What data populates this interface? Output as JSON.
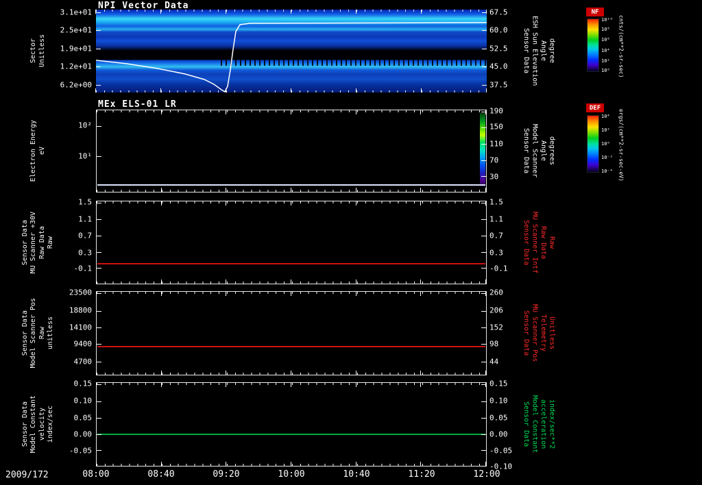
{
  "colors": {
    "background": "#000000",
    "text": "#ffffff",
    "red_label": "#ff2a2a",
    "green_label": "#00dd55",
    "red_line": "#cc1111",
    "green_line": "#00aa44",
    "badge_bg": "#cc0000"
  },
  "x_axis": {
    "date": "2009/172",
    "ticks": [
      "08:00",
      "08:40",
      "09:20",
      "10:00",
      "10:40",
      "11:20",
      "12:00"
    ]
  },
  "colorbars": [
    {
      "name": "NF",
      "units": "cnts/(cm**2-sr-sec)",
      "ticks": [
        "10¹⁰",
        "10⁸",
        "10⁶",
        "10⁴",
        "10²",
        "10⁰"
      ],
      "tick_pos": [
        2,
        20,
        40,
        60,
        80,
        98
      ]
    },
    {
      "name": "DEF",
      "units": "ergs/(cm**2-sr-sec-eV)",
      "ticks": [
        "10⁴",
        "10²",
        "10⁰",
        "10⁻²",
        "10⁻⁴"
      ],
      "tick_pos": [
        2,
        26,
        50,
        74,
        98
      ]
    }
  ],
  "chart_data": [
    {
      "type": "heatmap",
      "title": "NPI Vector Data",
      "ylabel_lines": [
        "Sector",
        "Unitless"
      ],
      "yticks": [
        "3.1e+01",
        "2.5e+01",
        "1.9e+01",
        "1.2e+01",
        "6.2e+00"
      ],
      "ytick_pos": [
        3,
        25,
        47,
        69,
        91
      ],
      "y2label_lines": [
        "Sensor Data",
        "ESH Sun Elevation",
        "Angle",
        "degree"
      ],
      "y2label_color": "#ffffff",
      "y2ticks": [
        "67.5",
        "60.0",
        "52.5",
        "45.0",
        "37.5"
      ],
      "y2tick_pos": [
        3,
        25,
        47,
        69,
        91
      ],
      "colorbar": "NF",
      "x_ticks": [
        "08:00",
        "08:40",
        "09:20",
        "10:00",
        "10:40",
        "11:20",
        "12:00"
      ],
      "overlay_line": {
        "color": "#ffffff",
        "description": "sun elevation trace: starts mid panel at 08:00, slopes down to panel bottom by ~08:25, jumps sharply to near top, then runs flat near top until 12:00"
      },
      "notes": "blue horizontally banded spectrogram spanning 08:00-12:00 with a black no-data band around sector ~14-16 and dark speckles right of ~09:20"
    },
    {
      "type": "heatmap",
      "title": "MEx ELS-01 LR",
      "ylabel_lines": [
        "Electron Energy",
        "eV"
      ],
      "yticks": [
        "10²",
        "10¹"
      ],
      "ytick_pos": [
        19,
        56
      ],
      "y2label_lines": [
        "Sensor Data",
        "Model Scanner",
        "Angle",
        "degrees"
      ],
      "y2label_color": "#ffffff",
      "y2ticks": [
        "190",
        "150",
        "110",
        "70",
        "30"
      ],
      "y2tick_pos": [
        2,
        21,
        41,
        61,
        81
      ],
      "colorbar": "DEF",
      "notes": "panel is black (no data) except a narrow multicolor energy-spectrum column at the far right edge near 12:00 and a bright line along the bottom"
    },
    {
      "type": "line",
      "ylabel_lines": [
        "Sensor Data",
        "MU Scanner +30V",
        "Raw Data",
        "Raw"
      ],
      "yticks": [
        "1.5",
        "1.1",
        "0.7",
        "0.3",
        "-0.1"
      ],
      "ytick_pos": [
        2,
        22,
        42,
        62,
        81
      ],
      "y2label_lines": [
        "Sensor Data",
        "MU Scanner Intf",
        "Raw Data",
        "Raw"
      ],
      "y2label_color": "#ff2a2a",
      "y2ticks": [
        "1.5",
        "1.1",
        "0.7",
        "0.3",
        "-0.1"
      ],
      "y2tick_pos": [
        2,
        22,
        42,
        62,
        81
      ],
      "series": [
        {
          "name": "MU Scanner +30V Raw",
          "color": "#cc1111",
          "value": 0.0,
          "pos_pct": 76,
          "shape": "constant horizontal line 08:00-12:00"
        }
      ]
    },
    {
      "type": "line",
      "ylabel_lines": [
        "Sensor Data",
        "Model Scanner Pos",
        "Raw",
        "unitless"
      ],
      "yticks": [
        "23500",
        "18800",
        "14100",
        "9400",
        "4700"
      ],
      "ytick_pos": [
        2,
        23,
        43,
        63,
        84
      ],
      "y2label_lines": [
        "Sensor Data",
        "MU Scanner Pos",
        "Telemetry",
        "Unitless"
      ],
      "y2label_color": "#ff2a2a",
      "y2ticks": [
        "260",
        "206",
        "152",
        "98",
        "44"
      ],
      "y2tick_pos": [
        2,
        23,
        43,
        63,
        84
      ],
      "series": [
        {
          "name": "Model Scanner Pos Raw",
          "color": "#cc1111",
          "value": 8700,
          "pos_pct": 66,
          "shape": "constant horizontal line 08:00-12:00"
        }
      ]
    },
    {
      "type": "line",
      "ylabel_lines": [
        "Sensor Data",
        "Model Constant",
        "velocity",
        "index/sec"
      ],
      "yticks": [
        "0.15",
        "0.10",
        "0.05",
        "0.00",
        "-0.05"
      ],
      "ytick_pos": [
        2,
        22,
        42,
        62,
        81
      ],
      "y2label_lines": [
        "Sensor Data",
        "Model Constant",
        "acceleration",
        "index/sec**2"
      ],
      "y2label_color": "#00dd55",
      "y2ticks": [
        "0.15",
        "0.10",
        "0.05",
        "0.00",
        "-0.05",
        "-0.10"
      ],
      "y2tick_pos": [
        2,
        22,
        42,
        62,
        81,
        100
      ],
      "series": [
        {
          "name": "Model Constant velocity",
          "color": "#00aa44",
          "value": 0.0,
          "pos_pct": 62,
          "shape": "constant horizontal line 08:00-12:00"
        }
      ]
    }
  ]
}
